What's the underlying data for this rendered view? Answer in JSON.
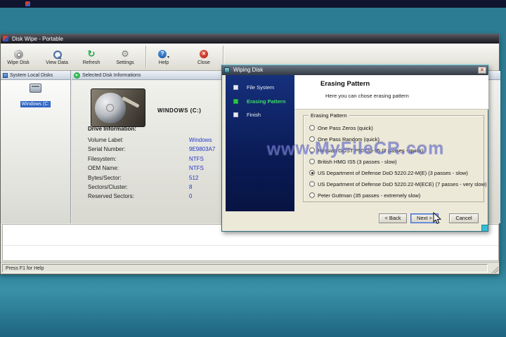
{
  "app": {
    "title": "Disk Wipe - Portable",
    "toolbar": {
      "items": [
        {
          "label": "Wipe Disk"
        },
        {
          "label": "View Data"
        },
        {
          "label": "Refresh"
        },
        {
          "label": "Settings"
        },
        {
          "label": "Help"
        },
        {
          "label": "Close"
        }
      ]
    },
    "left_panel": {
      "header": "System Local Disks",
      "disk_label": "Windows (C:"
    },
    "right_panel": {
      "header": "Selected Disk Informations",
      "disk_title": "WINDOWS  (C:)",
      "drive_info_title": "Drive Information:",
      "fields": [
        {
          "label": "Volume Label:",
          "value": "Windows"
        },
        {
          "label": "Serial Number:",
          "value": "9E9803A7"
        },
        {
          "label": "Filesystem:",
          "value": "NTFS"
        },
        {
          "label": "OEM Name:",
          "value": "NTFS"
        },
        {
          "label": "Bytes/Sector:",
          "value": "512"
        },
        {
          "label": "Sectors/Cluster:",
          "value": "8"
        },
        {
          "label": "Reserved Sectors:",
          "value": "0"
        }
      ]
    },
    "status_bar": {
      "help_text": "Press F1 for Help"
    }
  },
  "dialog": {
    "title": "Wiping Disk",
    "steps": [
      {
        "label": "File System",
        "active": false
      },
      {
        "label": "Erasing Pattern",
        "active": true
      },
      {
        "label": "Finish",
        "active": false
      }
    ],
    "header": {
      "title": "Erasing Pattern",
      "subtitle": "Here you can chose erasing pattern"
    },
    "group_title": "Erasing Pattern",
    "options": [
      {
        "label": "One Pass Zeros (quick)",
        "selected": false
      },
      {
        "label": "One Pass Random (quick)",
        "selected": false
      },
      {
        "label": "Russian GOST P50739-95 (2 passes - quick)",
        "selected": false
      },
      {
        "label": "British HMG IS5 (3 passes - slow)",
        "selected": false
      },
      {
        "label": "US Department of Defense DoD 5220.22-M(E) (3 passes - slow)",
        "selected": true
      },
      {
        "label": "US Department of Defense DoD 5220.22-M(ECE) (7 passes - very slow)",
        "selected": false
      },
      {
        "label": "Peter Guttman (35 passes - extremely slow)",
        "selected": false
      }
    ],
    "buttons": {
      "back": "< Back",
      "next": "Next >",
      "cancel": "Cancel"
    },
    "watermark": "www.MyFileCR.com"
  },
  "colors": {
    "desktop_teal": "#2c7c94",
    "selection_blue": "#2f64c2",
    "value_blue": "#2238c8",
    "active_step_green": "#2bc848"
  }
}
